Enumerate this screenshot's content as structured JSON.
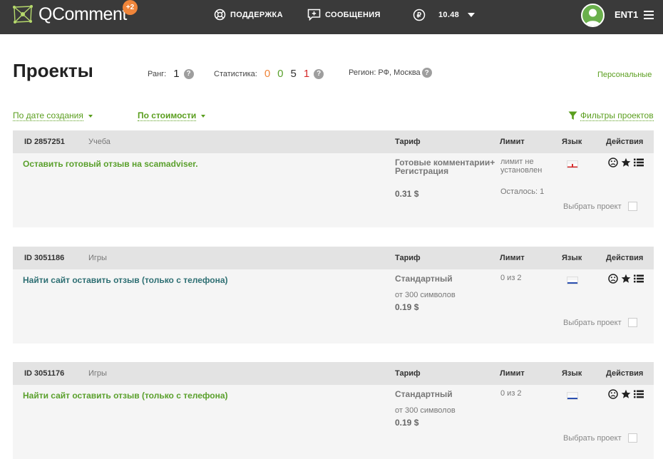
{
  "header": {
    "logo_text": "QComment",
    "logo_badge": "+2",
    "support": "ПОДДЕРЖКА",
    "messages": "СООБЩЕНИЯ",
    "balance": "10.48",
    "user": "ENT1"
  },
  "page": {
    "title": "Проекты",
    "rank_label": "Ранг:",
    "rank_value": "1",
    "stats_label": "Статистика:",
    "stats": [
      "0",
      "0",
      "5",
      "1"
    ],
    "stats_colors": [
      "#f0853a",
      "#5aa02c",
      "#333333",
      "#d62b2b"
    ],
    "region": "Регион: РФ, Москва",
    "personal": "Персональные",
    "sort_date": "По дате создания",
    "sort_cost": "По стоимости",
    "filters": "Фильтры проектов"
  },
  "columns": {
    "tariff": "Тариф",
    "limit": "Лимит",
    "lang": "Язык",
    "actions": "Действия",
    "select": "Выбрать проект"
  },
  "projects": [
    {
      "id": "ID 2857251",
      "category": "Учеба",
      "title": "Оставить готовый отзыв на scamadviser.",
      "tariff": "Готовые комментарии+Регистрация",
      "tariff_sub": "",
      "price": "0.31 $",
      "limit": "лимит не установлен",
      "remaining": "Осталось: 1",
      "lang": "en"
    },
    {
      "id": "ID 3051186",
      "category": "Игры",
      "title": "Найти сайт оставить отзыв (только с телефона)",
      "tariff": "Стандартный",
      "tariff_sub": "от 300 символов",
      "price": "0.19 $",
      "limit": "0 из 2",
      "remaining": "",
      "lang": "ru"
    },
    {
      "id": "ID 3051176",
      "category": "Игры",
      "title": "Найти сайт оставить отзыв (только с телефона)",
      "tariff": "Стандартный",
      "tariff_sub": "от 300 символов",
      "price": "0.19 $",
      "limit": "0 из 2",
      "remaining": "",
      "lang": "ru"
    }
  ]
}
